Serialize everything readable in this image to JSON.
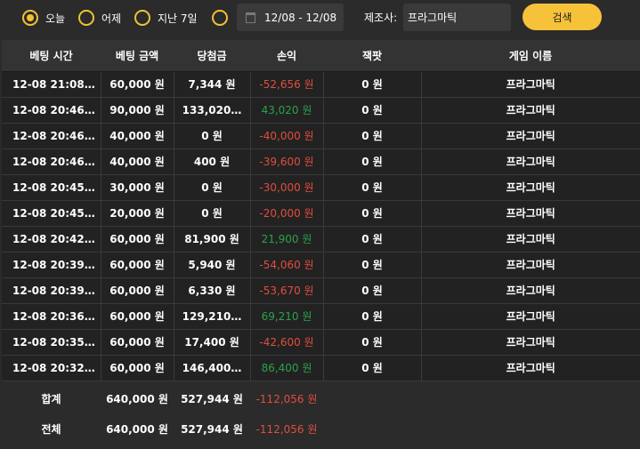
{
  "filters": {
    "today_label": "오늘",
    "yesterday_label": "어제",
    "last7_label": "지난 7일",
    "date_range": "12/08 - 12/08",
    "maker_label": "제조사:",
    "maker_value": "프라그마틱",
    "search_label": "검색"
  },
  "table": {
    "headers": [
      "베팅 시간",
      "베팅 금액",
      "당첨금",
      "손익",
      "잭팟",
      "게임 이름"
    ],
    "rows": [
      {
        "time": "12-08 21:08:…",
        "bet": "60,000 원",
        "win": "7,344 원",
        "pl": "-52,656 원",
        "pl_sign": "neg",
        "jackpot": "0 원",
        "game": "프라그마틱"
      },
      {
        "time": "12-08 20:46:…",
        "bet": "90,000 원",
        "win": "133,020…",
        "pl": "43,020 원",
        "pl_sign": "pos",
        "jackpot": "0 원",
        "game": "프라그마틱"
      },
      {
        "time": "12-08 20:46:…",
        "bet": "40,000 원",
        "win": "0 원",
        "pl": "-40,000 원",
        "pl_sign": "neg",
        "jackpot": "0 원",
        "game": "프라그마틱"
      },
      {
        "time": "12-08 20:46:…",
        "bet": "40,000 원",
        "win": "400 원",
        "pl": "-39,600 원",
        "pl_sign": "neg",
        "jackpot": "0 원",
        "game": "프라그마틱"
      },
      {
        "time": "12-08 20:45:…",
        "bet": "30,000 원",
        "win": "0 원",
        "pl": "-30,000 원",
        "pl_sign": "neg",
        "jackpot": "0 원",
        "game": "프라그마틱"
      },
      {
        "time": "12-08 20:45:…",
        "bet": "20,000 원",
        "win": "0 원",
        "pl": "-20,000 원",
        "pl_sign": "neg",
        "jackpot": "0 원",
        "game": "프라그마틱"
      },
      {
        "time": "12-08 20:42:…",
        "bet": "60,000 원",
        "win": "81,900 원",
        "pl": "21,900 원",
        "pl_sign": "pos",
        "jackpot": "0 원",
        "game": "프라그마틱"
      },
      {
        "time": "12-08 20:39:…",
        "bet": "60,000 원",
        "win": "5,940 원",
        "pl": "-54,060 원",
        "pl_sign": "neg",
        "jackpot": "0 원",
        "game": "프라그마틱"
      },
      {
        "time": "12-08 20:39:…",
        "bet": "60,000 원",
        "win": "6,330 원",
        "pl": "-53,670 원",
        "pl_sign": "neg",
        "jackpot": "0 원",
        "game": "프라그마틱"
      },
      {
        "time": "12-08 20:36:…",
        "bet": "60,000 원",
        "win": "129,210…",
        "pl": "69,210 원",
        "pl_sign": "pos",
        "jackpot": "0 원",
        "game": "프라그마틱"
      },
      {
        "time": "12-08 20:35:…",
        "bet": "60,000 원",
        "win": "17,400 원",
        "pl": "-42,600 원",
        "pl_sign": "neg",
        "jackpot": "0 원",
        "game": "프라그마틱"
      },
      {
        "time": "12-08 20:32:…",
        "bet": "60,000 원",
        "win": "146,400…",
        "pl": "86,400 원",
        "pl_sign": "pos",
        "jackpot": "0 원",
        "game": "프라그마틱"
      }
    ],
    "subtotal": {
      "label": "합계",
      "bet": "640,000 원",
      "win": "527,944 원",
      "pl": "-112,056 원"
    },
    "total": {
      "label": "전체",
      "bet": "640,000 원",
      "win": "527,944 원",
      "pl": "-112,056 원"
    }
  },
  "colors": {
    "accent": "#f6c23a",
    "loss": "#e14d3f",
    "gain": "#2aa24b"
  }
}
